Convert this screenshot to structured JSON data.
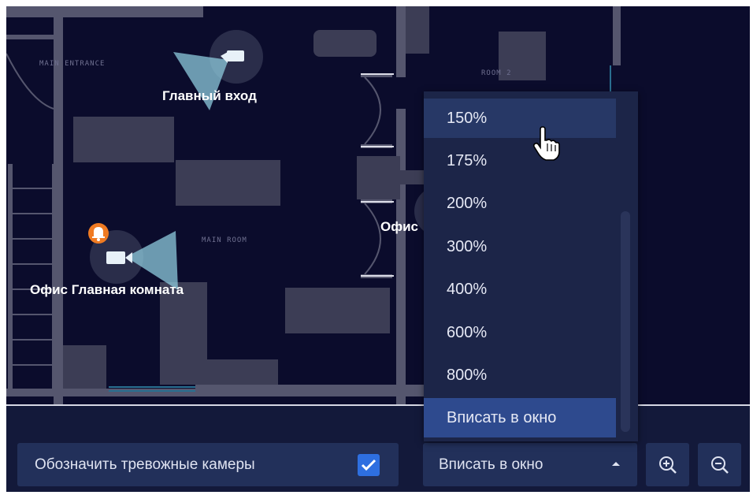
{
  "map": {
    "rooms": [
      {
        "label": "MAIN ENTRANCE"
      },
      {
        "label": "ROOM 2"
      },
      {
        "label": "MAIN ROOM"
      }
    ],
    "cameras": [
      {
        "label": "Главный вход",
        "alarm": false
      },
      {
        "label": "Офис Главная комната",
        "alarm": true
      },
      {
        "label": "Офис",
        "alarm": false
      }
    ]
  },
  "controls": {
    "alarm_cameras_label": "Обозначить тревожные камеры",
    "alarm_cameras_checked": true,
    "zoom_selected": "Вписать в окно",
    "zoom_in_icon": "zoom-in-icon",
    "zoom_out_icon": "zoom-out-icon"
  },
  "zoom_dropdown": {
    "options": [
      "150%",
      "175%",
      "200%",
      "300%",
      "400%",
      "600%",
      "800%",
      "Вписать в окно"
    ],
    "hovered": "150%",
    "selected": "Вписать в окно"
  },
  "colors": {
    "background": "#0b0c2c",
    "panel": "#13193a",
    "button": "#22305a",
    "accent": "#2e6fe0",
    "alarm": "#f07b22"
  }
}
